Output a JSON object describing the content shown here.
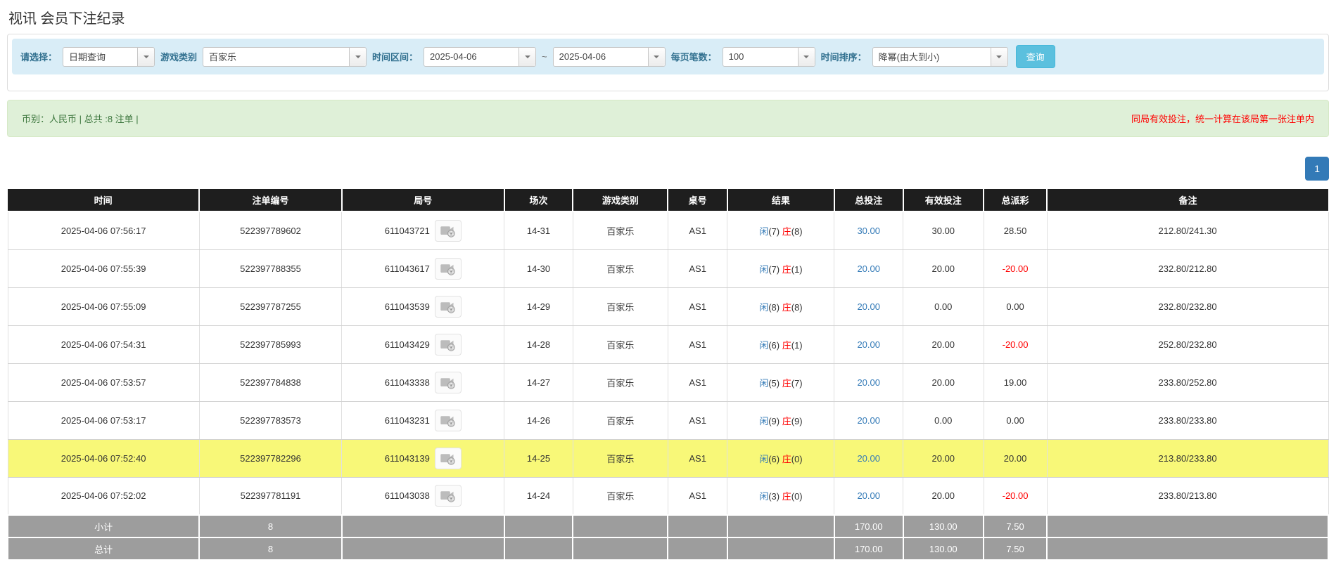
{
  "page": {
    "title": "视讯 会员下注纪录"
  },
  "filters": {
    "select_label": "请选择：",
    "select_value": "日期查询",
    "game_label": "游戏类别",
    "game_value": "百家乐",
    "range_label": "时间区间：",
    "range_from": "2025-04-06",
    "range_tilde": "~",
    "range_to": "2025-04-06",
    "page_size_label": "每页笔数：",
    "page_size_value": "100",
    "sort_label": "时间排序：",
    "sort_value": "降幂(由大到小)",
    "query_button": "查询"
  },
  "summary": {
    "left": "币别：人民币 | 总共 :8 注单 |",
    "right": "同局有效投注，统一计算在该局第一张注单内"
  },
  "pagination": {
    "current": "1"
  },
  "table": {
    "headers": [
      "时间",
      "注单编号",
      "局号",
      "场次",
      "游戏类别",
      "桌号",
      "结果",
      "总投注",
      "有效投注",
      "总派彩",
      "备注"
    ],
    "col_widths": [
      "14.5%",
      "10.8%",
      "12.3%",
      "5.2%",
      "7.2%",
      "4.5%",
      "8.1%",
      "5.2%",
      "6.1%",
      "4.8%",
      "21.3%"
    ],
    "rows": [
      {
        "time": "2025-04-06 07:56:17",
        "bet_id": "522397789602",
        "round_id": "611043721",
        "session": "14-31",
        "game": "百家乐",
        "table_no": "AS1",
        "result": {
          "player": "闲",
          "player_score": "(7)",
          "banker": "庄",
          "banker_score": "(8)"
        },
        "total_bet": "30.00",
        "valid_bet": "30.00",
        "payout": "28.50",
        "remark": "212.80/241.30",
        "highlight": false
      },
      {
        "time": "2025-04-06 07:55:39",
        "bet_id": "522397788355",
        "round_id": "611043617",
        "session": "14-30",
        "game": "百家乐",
        "table_no": "AS1",
        "result": {
          "player": "闲",
          "player_score": "(7)",
          "banker": "庄",
          "banker_score": "(1)"
        },
        "total_bet": "20.00",
        "valid_bet": "20.00",
        "payout": "-20.00",
        "remark": "232.80/212.80",
        "highlight": false
      },
      {
        "time": "2025-04-06 07:55:09",
        "bet_id": "522397787255",
        "round_id": "611043539",
        "session": "14-29",
        "game": "百家乐",
        "table_no": "AS1",
        "result": {
          "player": "闲",
          "player_score": "(8)",
          "banker": "庄",
          "banker_score": "(8)"
        },
        "total_bet": "20.00",
        "valid_bet": "0.00",
        "payout": "0.00",
        "remark": "232.80/232.80",
        "highlight": false
      },
      {
        "time": "2025-04-06 07:54:31",
        "bet_id": "522397785993",
        "round_id": "611043429",
        "session": "14-28",
        "game": "百家乐",
        "table_no": "AS1",
        "result": {
          "player": "闲",
          "player_score": "(6)",
          "banker": "庄",
          "banker_score": "(1)"
        },
        "total_bet": "20.00",
        "valid_bet": "20.00",
        "payout": "-20.00",
        "remark": "252.80/232.80",
        "highlight": false
      },
      {
        "time": "2025-04-06 07:53:57",
        "bet_id": "522397784838",
        "round_id": "611043338",
        "session": "14-27",
        "game": "百家乐",
        "table_no": "AS1",
        "result": {
          "player": "闲",
          "player_score": "(5)",
          "banker": "庄",
          "banker_score": "(7)"
        },
        "total_bet": "20.00",
        "valid_bet": "20.00",
        "payout": "19.00",
        "remark": "233.80/252.80",
        "highlight": false
      },
      {
        "time": "2025-04-06 07:53:17",
        "bet_id": "522397783573",
        "round_id": "611043231",
        "session": "14-26",
        "game": "百家乐",
        "table_no": "AS1",
        "result": {
          "player": "闲",
          "player_score": "(9)",
          "banker": "庄",
          "banker_score": "(9)"
        },
        "total_bet": "20.00",
        "valid_bet": "0.00",
        "payout": "0.00",
        "remark": "233.80/233.80",
        "highlight": false
      },
      {
        "time": "2025-04-06 07:52:40",
        "bet_id": "522397782296",
        "round_id": "611043139",
        "session": "14-25",
        "game": "百家乐",
        "table_no": "AS1",
        "result": {
          "player": "闲",
          "player_score": "(6)",
          "banker": "庄",
          "banker_score": "(0)"
        },
        "total_bet": "20.00",
        "valid_bet": "20.00",
        "payout": "20.00",
        "remark": "213.80/233.80",
        "highlight": true
      },
      {
        "time": "2025-04-06 07:52:02",
        "bet_id": "522397781191",
        "round_id": "611043038",
        "session": "14-24",
        "game": "百家乐",
        "table_no": "AS1",
        "result": {
          "player": "闲",
          "player_score": "(3)",
          "banker": "庄",
          "banker_score": "(0)"
        },
        "total_bet": "20.00",
        "valid_bet": "20.00",
        "payout": "-20.00",
        "remark": "233.80/213.80",
        "highlight": false
      }
    ],
    "footer": [
      {
        "label": "小计",
        "count": "8",
        "total_bet": "170.00",
        "valid_bet": "130.00",
        "payout": "7.50"
      },
      {
        "label": "总计",
        "count": "8",
        "total_bet": "170.00",
        "valid_bet": "130.00",
        "payout": "7.50"
      }
    ]
  },
  "icons": {
    "combo_arrow": "chevron-down-icon",
    "round_action": "video-replay-icon"
  },
  "colors": {
    "filter_bar_bg": "#d9edf7",
    "filter_label": "#31708f",
    "query_button_bg": "#5bc0de",
    "summary_bg": "#dff0d8",
    "summary_text": "#3c763d",
    "summary_warning": "#ff0000",
    "pagination_active": "#337ab7",
    "table_header_bg": "#1e1e1e",
    "highlight_row_bg": "#f8f878",
    "footer_row_bg": "#9d9d9d",
    "link_blue": "#337ab7",
    "player_blue": "#337ab7",
    "banker_red": "#ff0000",
    "negative_red": "#ff0000"
  }
}
